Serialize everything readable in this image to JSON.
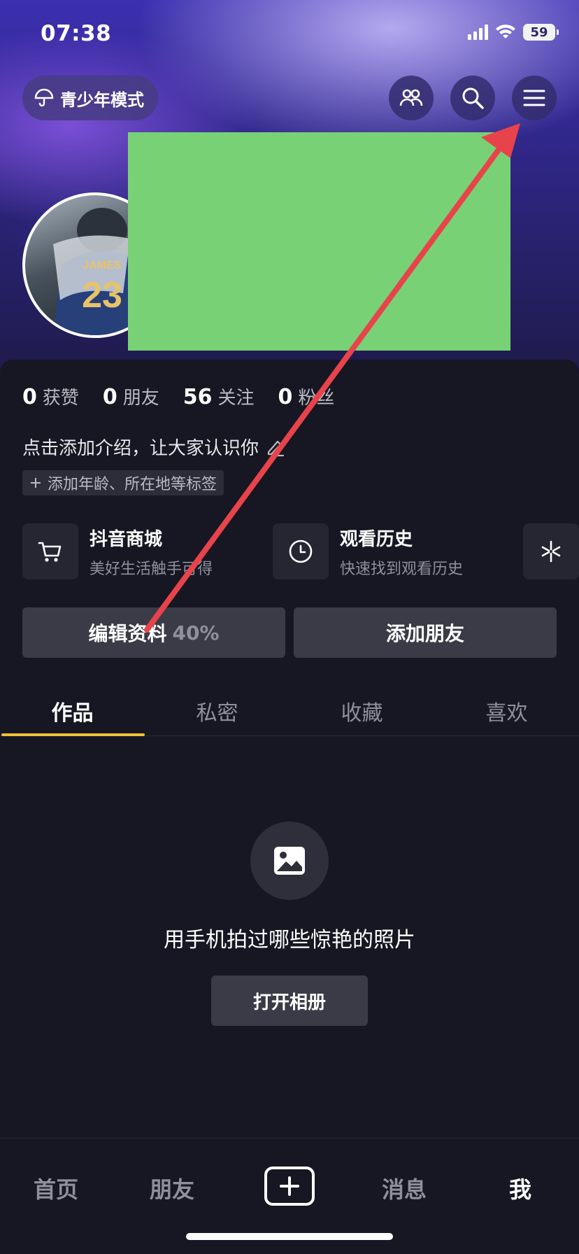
{
  "status": {
    "time": "07:38",
    "battery": "59"
  },
  "header": {
    "teen_mode_label": "青少年模式"
  },
  "stats": [
    {
      "num": "0",
      "label": "获赞"
    },
    {
      "num": "0",
      "label": "朋友"
    },
    {
      "num": "56",
      "label": "关注"
    },
    {
      "num": "0",
      "label": "粉丝"
    }
  ],
  "bio": {
    "text": "点击添加介绍，让大家认识你",
    "tag_button": "添加年龄、所在地等标签"
  },
  "shortcuts": [
    {
      "title": "抖音商城",
      "subtitle": "美好生活触手可得",
      "icon": "cart-icon"
    },
    {
      "title": "观看历史",
      "subtitle": "快速找到观看历史",
      "icon": "clock-icon"
    }
  ],
  "actions": {
    "edit_profile": "编辑资料",
    "edit_percent": "40%",
    "add_friend": "添加朋友"
  },
  "tabs": [
    "作品",
    "私密",
    "收藏",
    "喜欢"
  ],
  "empty": {
    "message": "用手机拍过哪些惊艳的照片",
    "button": "打开相册"
  },
  "nav": {
    "home": "首页",
    "friends": "朋友",
    "messages": "消息",
    "me": "我"
  },
  "colors": {
    "accent": "#f1c232",
    "annotation": "#e8434b",
    "redaction": "#78d275"
  }
}
